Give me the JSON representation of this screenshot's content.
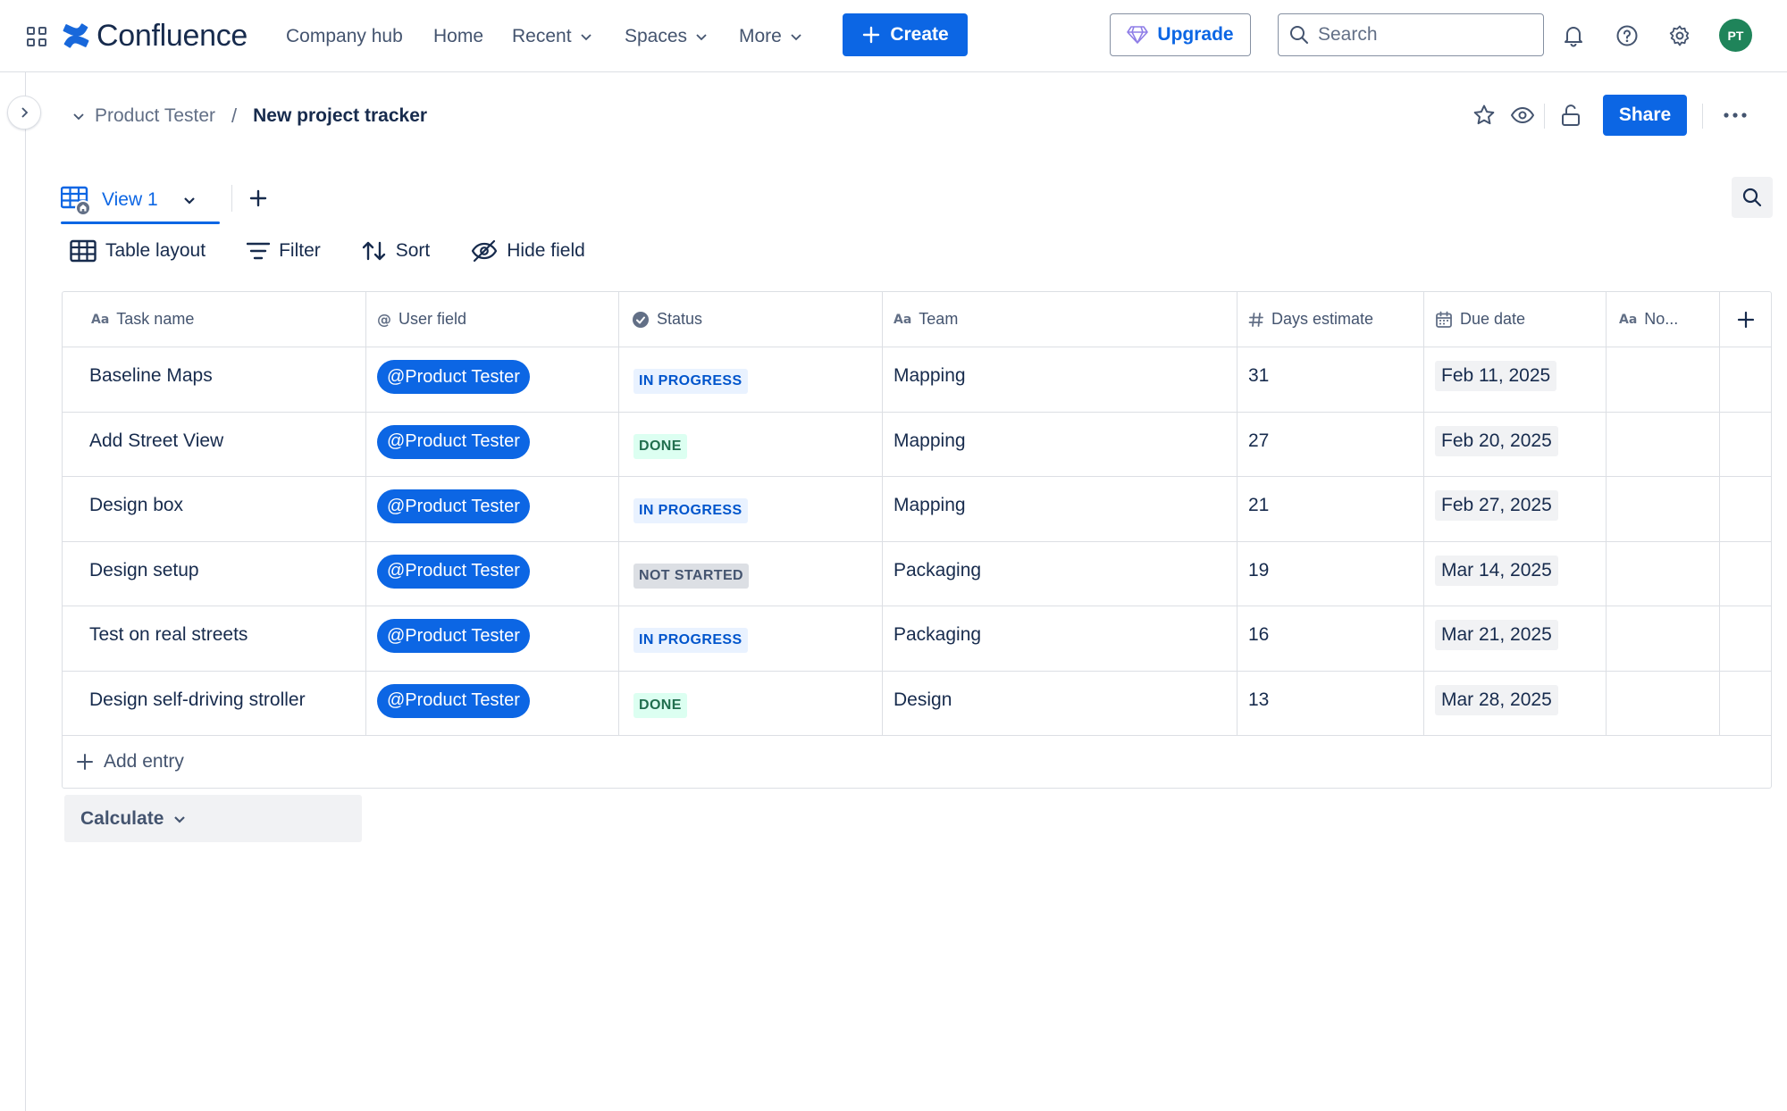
{
  "topnav": {
    "app_name": "Confluence",
    "nav_items": [
      {
        "label": "Company hub",
        "dropdown": false
      },
      {
        "label": "Home",
        "dropdown": false
      },
      {
        "label": "Recent",
        "dropdown": true
      },
      {
        "label": "Spaces",
        "dropdown": true
      },
      {
        "label": "More",
        "dropdown": true
      }
    ],
    "create_label": "Create",
    "upgrade_label": "Upgrade",
    "search_placeholder": "Search",
    "avatar_initials": "PT",
    "icons": [
      "app-switcher-icon",
      "bell-icon",
      "help-icon",
      "settings-icon"
    ]
  },
  "breadcrumb": {
    "space": "Product Tester",
    "separator": "/",
    "current": "New project tracker"
  },
  "page_actions": {
    "share_label": "Share",
    "icons": [
      "star-icon",
      "watch-icon",
      "unlock-icon",
      "more-icon"
    ]
  },
  "views": {
    "active_tab": "View 1"
  },
  "toolbar": {
    "layout_label": "Table layout",
    "filter_label": "Filter",
    "sort_label": "Sort",
    "hide_label": "Hide field"
  },
  "table": {
    "columns": [
      {
        "label": "Task name",
        "icon": "text-field-icon"
      },
      {
        "label": "User field",
        "icon": "at-icon"
      },
      {
        "label": "Status",
        "icon": "status-icon"
      },
      {
        "label": "Team",
        "icon": "text-field-icon"
      },
      {
        "label": "Days estimate",
        "icon": "number-icon"
      },
      {
        "label": "Due date",
        "icon": "calendar-icon"
      },
      {
        "label": "No...",
        "icon": "text-field-icon"
      }
    ],
    "rows": [
      {
        "task": "Baseline Maps",
        "user": "@Product Tester",
        "status": "IN PROGRESS",
        "team": "Mapping",
        "days": "31",
        "due": "Feb 11, 2025",
        "notes": ""
      },
      {
        "task": "Add Street View",
        "user": "@Product Tester",
        "status": "DONE",
        "team": "Mapping",
        "days": "27",
        "due": "Feb 20, 2025",
        "notes": ""
      },
      {
        "task": "Design box",
        "user": "@Product Tester",
        "status": "IN PROGRESS",
        "team": "Mapping",
        "days": "21",
        "due": "Feb 27, 2025",
        "notes": ""
      },
      {
        "task": "Design setup",
        "user": "@Product Tester",
        "status": "NOT STARTED",
        "team": "Packaging",
        "days": "19",
        "due": "Mar 14, 2025",
        "notes": ""
      },
      {
        "task": "Test on real streets",
        "user": "@Product Tester",
        "status": "IN PROGRESS",
        "team": "Packaging",
        "days": "16",
        "due": "Mar 21, 2025",
        "notes": ""
      },
      {
        "task": "Design self-driving stroller",
        "user": "@Product Tester",
        "status": "DONE",
        "team": "Design",
        "days": "13",
        "due": "Mar 28, 2025",
        "notes": ""
      }
    ],
    "add_entry_label": "Add entry"
  },
  "calculate_label": "Calculate",
  "colors": {
    "brand_blue": "#0c66e4",
    "avatar_green": "#1f845a",
    "in_progress_bg": "#e9f2ff",
    "done_bg": "#dcfff1",
    "not_started_bg": "#dcdfe4"
  }
}
